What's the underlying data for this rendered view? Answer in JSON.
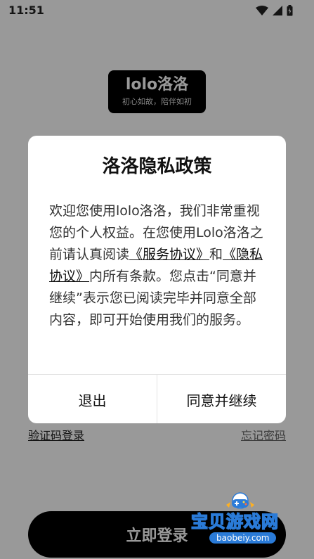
{
  "status_bar": {
    "time": "11:51"
  },
  "logo": {
    "title": "lolo洛洛",
    "slogan": "初心如故，陪伴如初"
  },
  "login": {
    "sms_login_link": "验证码登录",
    "forgot_password_link": "忘记密码",
    "login_button": "立即登录"
  },
  "dialog": {
    "title": "洛洛隐私政策",
    "body_part1": "欢迎您使用lolo洛洛，我们非常重视您的个人权益。在您使用Lolo洛洛之前请认真阅读",
    "service_agreement_link": "《服务协议》",
    "body_part2": "和",
    "privacy_agreement_link": "《隐私协议》",
    "body_part3": "内所有条款。您点击“同意并继续”表示您已阅读完毕并同意全部内容，即可开始使用我们的服务。",
    "exit_button": "退出",
    "agree_button": "同意并继续"
  },
  "watermark": {
    "text": "宝贝游戏网",
    "url": "baobeiy.com"
  },
  "icons": {
    "wifi": "wifi-icon",
    "signal": "signal-icon",
    "battery": "battery-icon"
  },
  "colors": {
    "scrim": "#000000",
    "dialog_bg": "#ffffff",
    "primary_button": "#000000",
    "watermark_blue": "#2a7bd8"
  }
}
